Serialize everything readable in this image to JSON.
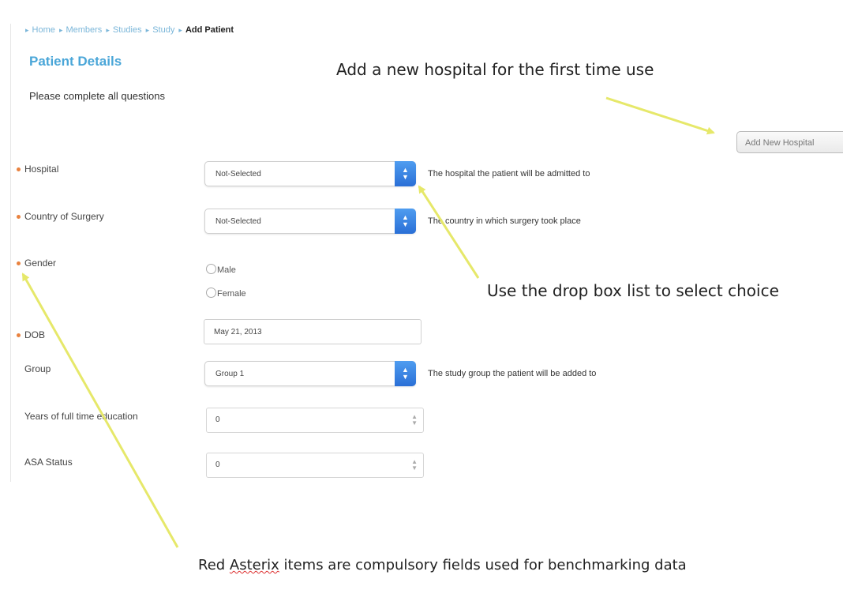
{
  "breadcrumb": {
    "items": [
      "Home",
      "Members",
      "Studies",
      "Study"
    ],
    "current": "Add Patient"
  },
  "page": {
    "title": "Patient Details",
    "subtitle": "Please complete all questions"
  },
  "add_hospital_button": "Add New Hospital",
  "fields": {
    "hospital": {
      "label": "Hospital",
      "value": "Not-Selected",
      "help": "The hospital the patient will be admitted to"
    },
    "country": {
      "label": "Country of Surgery",
      "value": "Not-Selected",
      "help": "The country in which surgery took place"
    },
    "gender": {
      "label": "Gender",
      "option_male": "Male",
      "option_female": "Female"
    },
    "dob": {
      "label": "DOB",
      "value": "May 21, 2013"
    },
    "group": {
      "label": "Group",
      "value": "Group 1",
      "help": "The study group the patient will be added to"
    },
    "education": {
      "label": "Years of full time education",
      "value": "0"
    },
    "asa": {
      "label": "ASA Status",
      "value": "0"
    }
  },
  "annotations": {
    "add_hospital": "Add a new hospital for the first time use",
    "drop_box": "Use the drop box list to select choice",
    "compulsory_prefix": "Red ",
    "compulsory_word": "Asterix",
    "compulsory_suffix": " items are compulsory fields used for benchmarking data"
  },
  "colors": {
    "link": "#7ab6d9",
    "title": "#4aa6d8",
    "required_dot": "#e9823f",
    "select_arrow": "#2a6fd6",
    "annotation_arrow": "#e6e86a"
  }
}
